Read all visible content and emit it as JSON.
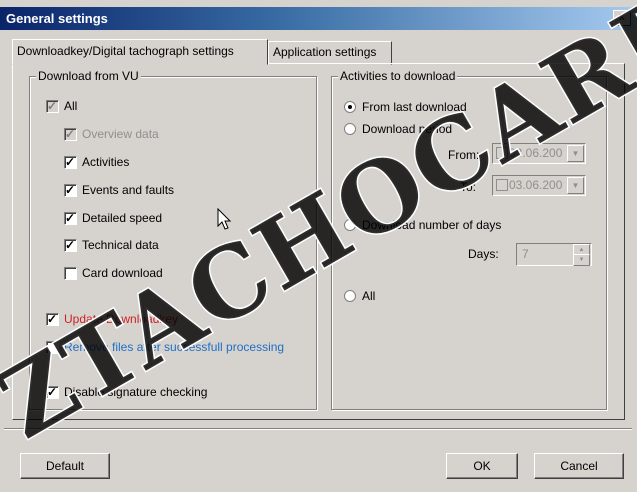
{
  "window": {
    "title": "General settings",
    "close_glyph": "x"
  },
  "tabs": [
    {
      "label": "Downloadkey/Digital tachograph settings",
      "active": true
    },
    {
      "label": "Application settings",
      "active": false
    }
  ],
  "download_group": {
    "legend": "Download from VU",
    "items": [
      {
        "label": "All",
        "checked": true,
        "enabled": false
      },
      {
        "label": "Overview data",
        "checked": true,
        "enabled": false
      },
      {
        "label": "Activities",
        "checked": true,
        "enabled": true
      },
      {
        "label": "Events and faults",
        "checked": true,
        "enabled": true
      },
      {
        "label": "Detailed speed",
        "checked": true,
        "enabled": true
      },
      {
        "label": "Technical data",
        "checked": true,
        "enabled": true
      },
      {
        "label": "Card download",
        "checked": false,
        "enabled": true
      }
    ],
    "update_downloadkey": "Update Downloadkey",
    "remove_files": "Remove files after successfull processing",
    "disable_signature": "Disable signature checking"
  },
  "activities_group": {
    "legend": "Activities to download",
    "from_last": "From last download",
    "download_period": "Download period",
    "from_label": "From:",
    "from_value": "03.06.200",
    "to_label": "To:",
    "to_value": "03.06.200",
    "number_of_days": "Download number of days",
    "days_label": "Days:",
    "days_value": "7",
    "all": "All"
  },
  "buttons": {
    "default": "Default",
    "ok": "OK",
    "cancel": "Cancel"
  },
  "watermark": "ZTACHOCARD",
  "colors": {
    "title_start": "#0a246a",
    "title_end": "#a6caf0",
    "warning_red": "#c22222",
    "link_blue": "#1f6fc6",
    "face": "#d6d3ce"
  }
}
